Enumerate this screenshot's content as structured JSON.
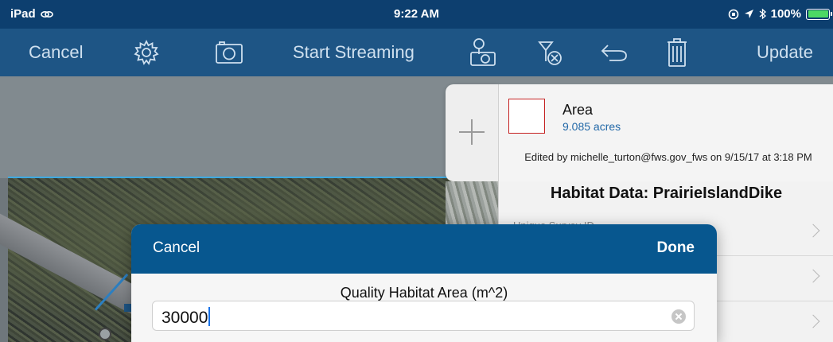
{
  "status_bar": {
    "device": "iPad",
    "time": "9:22 AM",
    "battery": "100%"
  },
  "toolbar": {
    "cancel_label": "Cancel",
    "start_streaming_label": "Start Streaming",
    "update_label": "Update",
    "icons": [
      "gear-icon",
      "camera-icon",
      "location-camera-icon",
      "clear-sketch-icon",
      "undo-icon",
      "trash-icon"
    ],
    "text_color": "#cfe0ef",
    "background": "#1e5585"
  },
  "feature_panel": {
    "title": "Area",
    "subtitle": "9.085 acres",
    "edited_info": "Edited by michelle_turton@fws.gov_fws on 9/15/17 at 3:18 PM",
    "layer_title": "Habitat Data: PrairieIslandDike",
    "rows": [
      {
        "label": "Unique Survey ID"
      },
      {
        "label": ""
      },
      {
        "label": ""
      }
    ],
    "swatch_color": "#c52222"
  },
  "dialog": {
    "cancel_label": "Cancel",
    "done_label": "Done",
    "field_label": "Quality Habitat Area (m^2)",
    "value": "30000",
    "bar_color": "#07578f"
  }
}
